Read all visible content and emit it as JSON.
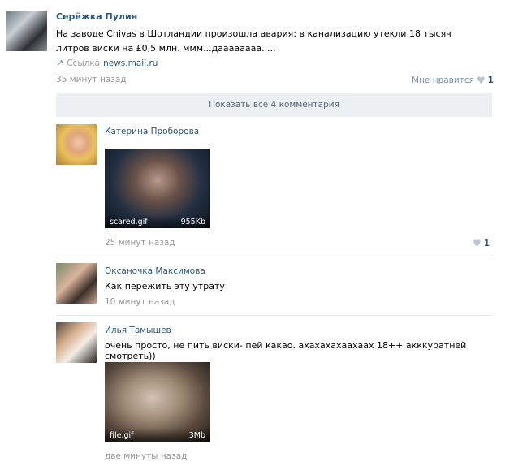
{
  "post": {
    "author": "Серёжка Пулин",
    "text": "На заводе Chivas в Шотландии произошла авария: в канализацию утекли 18 тысяч литров виски на £0,5 млн. ммм...даааааааа.....",
    "link_label": "Ссылка",
    "link_domain": "news.mail.ru",
    "time": "35 минут назад",
    "like_label": "Мне нравится",
    "like_count": "1"
  },
  "show_all": "Показать все 4 комментария",
  "comments": [
    {
      "name": "Катерина Проборова",
      "attachment": {
        "file": "scared.gif",
        "size": "955Kb"
      },
      "time": "25 минут назад",
      "like_count": "1"
    },
    {
      "name": "Оксаночка Максимова",
      "text": "Как пережить эту утрату",
      "time": "10 минут назад"
    },
    {
      "name": "Илья Тамышев",
      "text": "очень просто, не пить виски- пей какао. ахахахахаахаах 18++ акккуратней смотреть))",
      "attachment": {
        "file": "file.gif",
        "size": "3Mb"
      },
      "time": "две минуты назад"
    }
  ]
}
